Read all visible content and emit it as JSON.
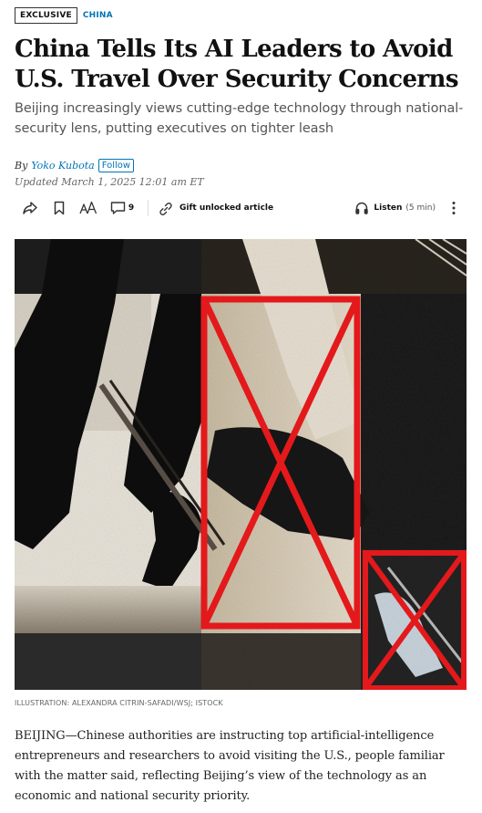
{
  "tags": {
    "exclusive": "EXCLUSIVE",
    "section": "CHINA"
  },
  "article": {
    "headline": "China Tells Its AI Leaders to Avoid U.S. Travel Over Security Concerns",
    "dek": "Beijing increasingly views cutting-edge technology through national-security lens, putting executives on tighter leash",
    "byline_prefix": "By",
    "author": "Yoko Kubota",
    "follow_label": "Follow",
    "updated": "Updated March 1, 2025 12:01 am ET",
    "caption": "ILLUSTRATION: ALEXANDRA CITRIN-SAFADI/WSJ; ISTOCK",
    "body": "BEIJING—Chinese authorities are instructing top artificial-intelligence entrepreneurs and researchers to avoid visiting the U.S., people familiar with the matter said, reflecting Beijing’s view of the technology as an economic and national security priority."
  },
  "toolbar": {
    "share_icon": "share-icon",
    "save_icon": "bookmark-icon",
    "text_size_icon": "text-size-icon",
    "comment_icon": "comment-icon",
    "comment_count": "9",
    "gift_icon": "link-icon",
    "gift_label": "Gift unlocked article",
    "listen_icon": "headphones-icon",
    "listen_label": "Listen",
    "listen_duration": "(5 min)",
    "more_icon": "more-vertical-icon"
  },
  "colors": {
    "accent_blue": "#0274b6",
    "illustration_red": "#e3191b",
    "text": "#111111",
    "muted": "#555555"
  }
}
